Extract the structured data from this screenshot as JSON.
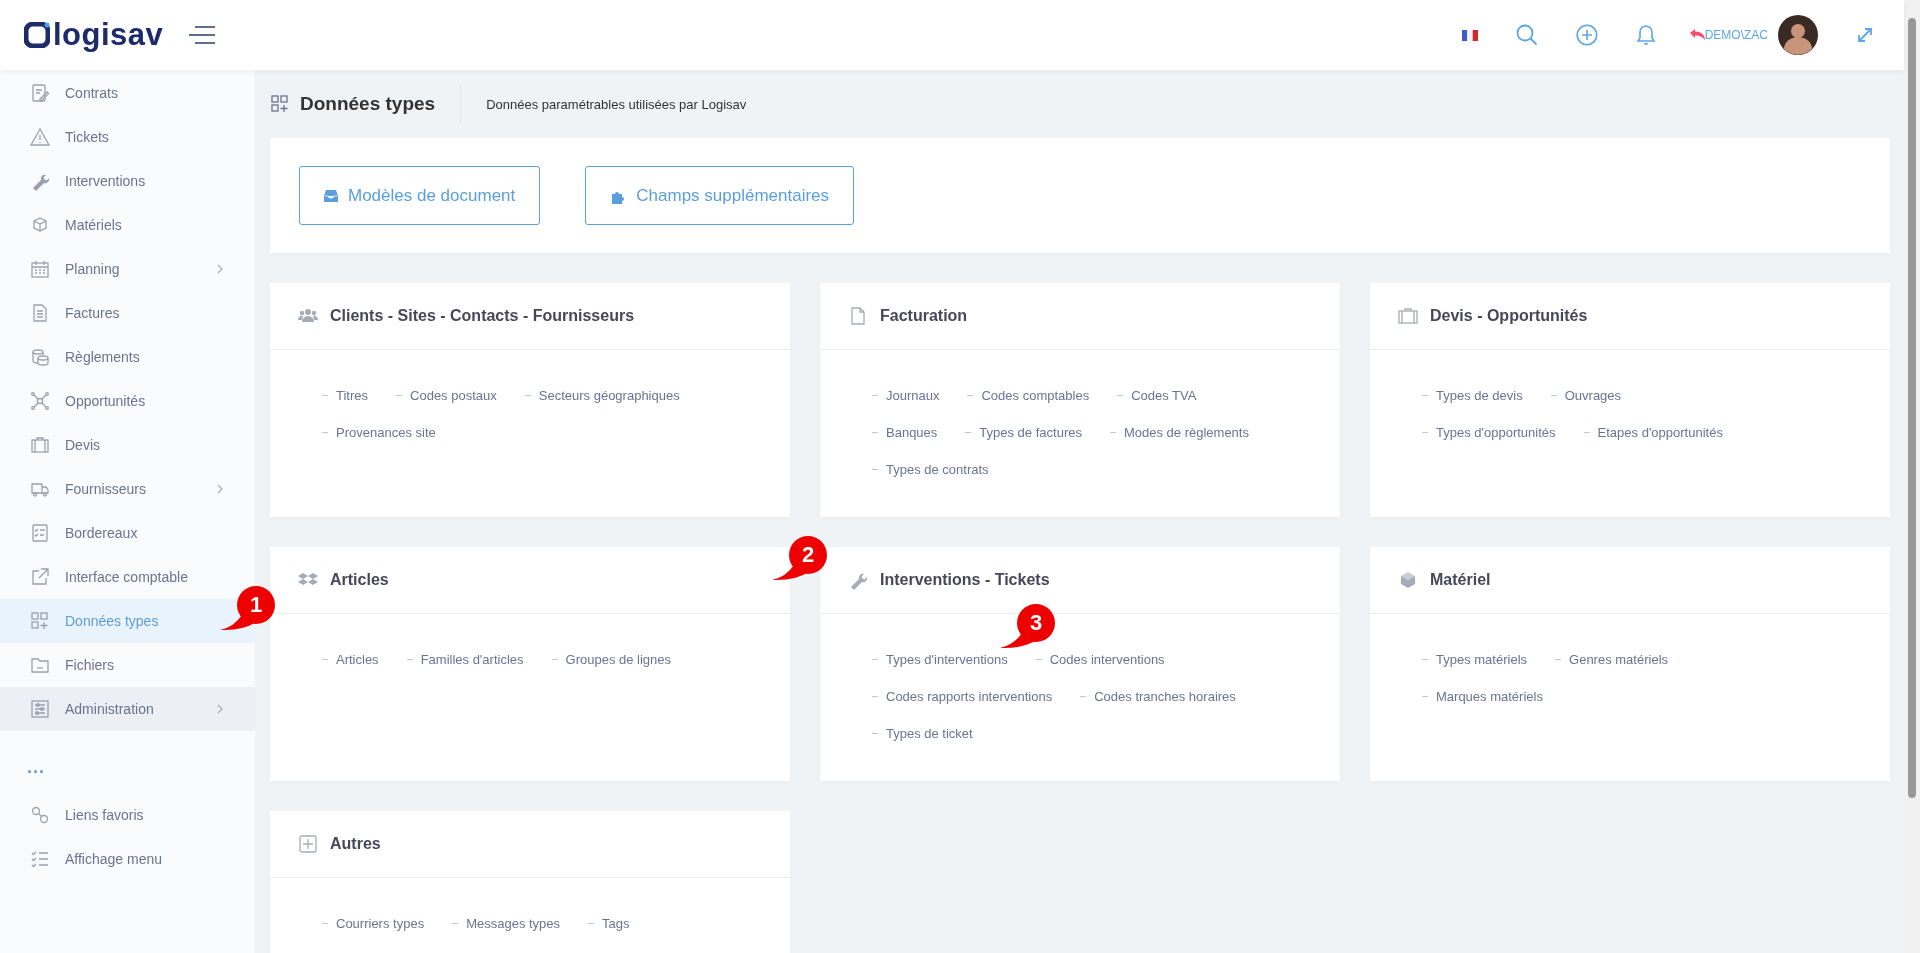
{
  "header": {
    "logo": "logisav",
    "user": "DEMO\\ZAC"
  },
  "sidebar": {
    "items": [
      {
        "label": "Contrats",
        "selected": false,
        "hovered": false,
        "submenu": false
      },
      {
        "label": "Tickets",
        "selected": false,
        "hovered": false,
        "submenu": false
      },
      {
        "label": "Interventions",
        "selected": false,
        "hovered": false,
        "submenu": false
      },
      {
        "label": "Matériels",
        "selected": false,
        "hovered": false,
        "submenu": false
      },
      {
        "label": "Planning",
        "selected": false,
        "hovered": false,
        "submenu": true
      },
      {
        "label": "Factures",
        "selected": false,
        "hovered": false,
        "submenu": false
      },
      {
        "label": "Règlements",
        "selected": false,
        "hovered": false,
        "submenu": false
      },
      {
        "label": "Opportunités",
        "selected": false,
        "hovered": false,
        "submenu": false
      },
      {
        "label": "Devis",
        "selected": false,
        "hovered": false,
        "submenu": false
      },
      {
        "label": "Fournisseurs",
        "selected": false,
        "hovered": false,
        "submenu": true
      },
      {
        "label": "Bordereaux",
        "selected": false,
        "hovered": false,
        "submenu": false
      },
      {
        "label": "Interface comptable",
        "selected": false,
        "hovered": false,
        "submenu": false
      },
      {
        "label": "Données types",
        "selected": true,
        "hovered": false,
        "submenu": false
      },
      {
        "label": "Fichiers",
        "selected": false,
        "hovered": false,
        "submenu": false
      },
      {
        "label": "Administration",
        "selected": false,
        "hovered": true,
        "submenu": true
      }
    ],
    "more": "...",
    "bottom_items": [
      {
        "label": "Liens favoris"
      },
      {
        "label": "Affichage menu"
      }
    ]
  },
  "page": {
    "title": "Données types",
    "subtitle": "Données paramétrables utilisées par Logisav"
  },
  "buttons": [
    {
      "label": "Modèles de document"
    },
    {
      "label": "Champs supplémentaires"
    }
  ],
  "cards": [
    {
      "title": "Clients - Sites - Contacts - Fournisseurs",
      "rows": [
        [
          "Titres",
          "Codes postaux",
          "Secteurs géographiques"
        ],
        [
          "Provenances site"
        ]
      ]
    },
    {
      "title": "Facturation",
      "rows": [
        [
          "Journaux",
          "Codes comptables",
          "Codes TVA"
        ],
        [
          "Banques",
          "Types de factures",
          "Modes de règlements"
        ],
        [
          "Types de contrats"
        ]
      ]
    },
    {
      "title": "Devis - Opportunités",
      "rows": [
        [
          "Types de devis",
          "Ouvrages"
        ],
        [
          "Types d'opportunités",
          "Etapes d'opportunités"
        ]
      ]
    },
    {
      "title": "Articles",
      "rows": [
        [
          "Articles",
          "Familles d'articles",
          "Groupes de lignes"
        ]
      ]
    },
    {
      "title": "Interventions - Tickets",
      "rows": [
        [
          "Types d'interventions",
          "Codes interventions"
        ],
        [
          "Codes rapports interventions",
          "Codes tranches horaires"
        ],
        [
          "Types de ticket"
        ]
      ]
    },
    {
      "title": "Matériel",
      "rows": [
        [
          "Types matériels",
          "Genres matériels"
        ],
        [
          "Marques matériels"
        ]
      ]
    },
    {
      "title": "Autres",
      "rows": [
        [
          "Courriers types",
          "Messages types",
          "Tags"
        ]
      ]
    }
  ],
  "callouts": [
    {
      "label": "1"
    },
    {
      "label": "2"
    },
    {
      "label": "3"
    }
  ]
}
